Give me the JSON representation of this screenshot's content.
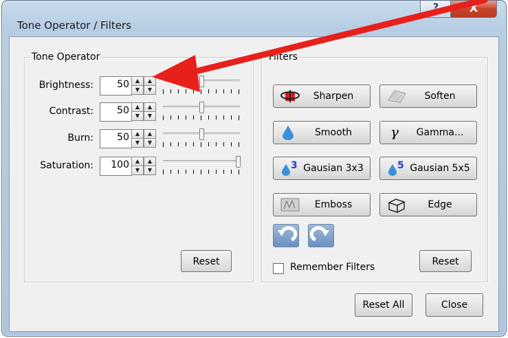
{
  "window": {
    "title": "Tone Operator / Filters",
    "help_glyph": "?",
    "close_glyph": "X"
  },
  "tone_operator": {
    "group_label": "Tone Operator",
    "rows": [
      {
        "label": "Brightness:",
        "value": "50",
        "level": 0.5
      },
      {
        "label": "Contrast:",
        "value": "50",
        "level": 0.5
      },
      {
        "label": "Burn:",
        "value": "50",
        "level": 0.5
      },
      {
        "label": "Saturation:",
        "value": "100",
        "level": 1.0
      }
    ],
    "reset_label": "Reset"
  },
  "filters": {
    "group_label": "Filters",
    "buttons": [
      {
        "label": "Sharpen",
        "icon": "sharpen-icon"
      },
      {
        "label": "Soften",
        "icon": "soften-icon"
      },
      {
        "label": "Smooth",
        "icon": "water-drop-icon"
      },
      {
        "label": "Gamma...",
        "icon": "gamma-icon"
      },
      {
        "label": "Gausian 3x3",
        "icon": "drop-3-icon",
        "icon_text": "3"
      },
      {
        "label": "Gausian 5x5",
        "icon": "drop-5-icon",
        "icon_text": "5"
      },
      {
        "label": "Emboss",
        "icon": "emboss-icon"
      },
      {
        "label": "Edge",
        "icon": "cube-edge-icon"
      }
    ],
    "gamma_glyph": "γ",
    "remember_label": "Remember Filters",
    "remember_checked": false,
    "reset_label": "Reset"
  },
  "footer": {
    "reset_all_label": "Reset All",
    "close_label": "Close"
  },
  "colors": {
    "arrow": "#e8201c",
    "drop": "#3a8fd8",
    "icon_digit": "#1c3fd0"
  }
}
